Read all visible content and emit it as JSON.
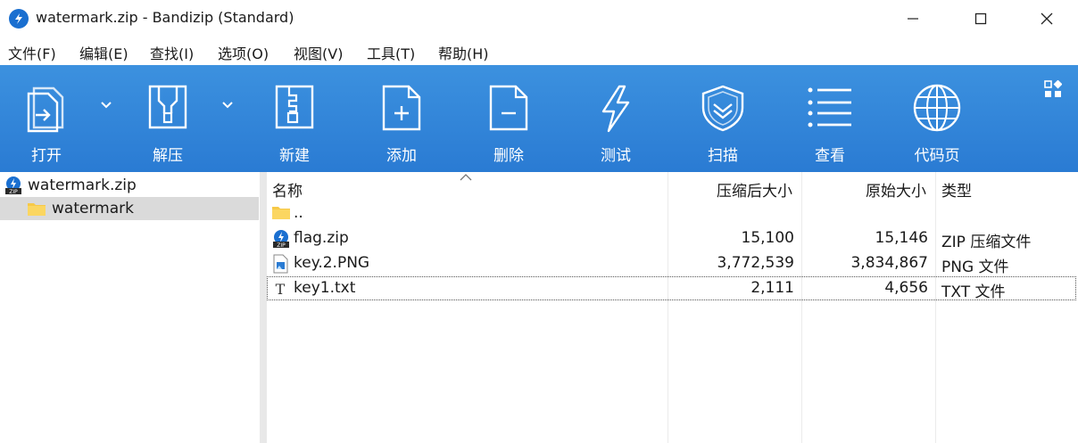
{
  "window": {
    "title": "watermark.zip - Bandizip (Standard)",
    "controls": {
      "minimize": "—",
      "maximize": "☐",
      "close": "✕"
    }
  },
  "menu": [
    {
      "label": "文件(F)"
    },
    {
      "label": "编辑(E)"
    },
    {
      "label": "查找(I)"
    },
    {
      "label": "选项(O)"
    },
    {
      "label": "视图(V)"
    },
    {
      "label": "工具(T)"
    },
    {
      "label": "帮助(H)"
    }
  ],
  "toolbar": {
    "open": "打开",
    "extract": "解压",
    "new": "新建",
    "add": "添加",
    "delete": "删除",
    "test": "测试",
    "scan": "扫描",
    "view": "查看",
    "codepage": "代码页"
  },
  "tree": {
    "root": "watermark.zip",
    "child": "watermark"
  },
  "columns": {
    "name": "名称",
    "packed": "压缩后大小",
    "original": "原始大小",
    "type": "类型"
  },
  "files": [
    {
      "name": "..",
      "packed": "",
      "original": "",
      "type": "",
      "icon": "folder-icon"
    },
    {
      "name": "flag.zip",
      "packed": "15,100",
      "original": "15,146",
      "type": "ZIP 压缩文件",
      "icon": "zip-file-icon"
    },
    {
      "name": "key.2.PNG",
      "packed": "3,772,539",
      "original": "3,834,867",
      "type": "PNG 文件",
      "icon": "png-file-icon"
    },
    {
      "name": "key1.txt",
      "packed": "2,111",
      "original": "4,656",
      "type": "TXT 文件",
      "icon": "txt-file-icon"
    }
  ],
  "colors": {
    "toolbar_top": "#3c91df",
    "toolbar_bottom": "#2a7bd3",
    "brand_blue": "#1a6fd0",
    "folder_yellow": "#f7c948",
    "selection_gray": "#dadada"
  }
}
